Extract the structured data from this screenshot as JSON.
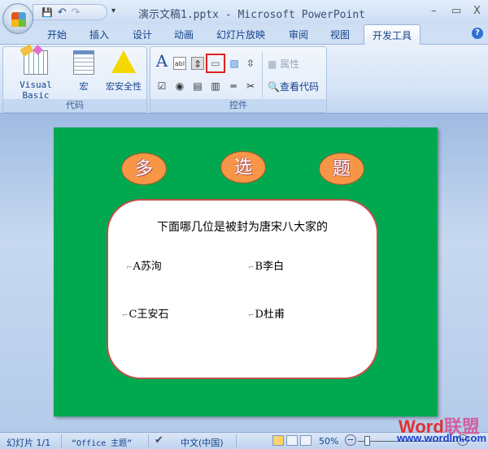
{
  "window": {
    "title": "演示文稿1.pptx - Microsoft PowerPoint",
    "minimize": "–",
    "maximize": "▭",
    "close": "X"
  },
  "qat": {
    "save": "💾",
    "undo": "↶",
    "redo": "↷",
    "more": "▾"
  },
  "tabs": [
    "开始",
    "插入",
    "设计",
    "动画",
    "幻灯片放映",
    "审阅",
    "视图"
  ],
  "active_tab": "开发工具",
  "help": "?",
  "ribbon": {
    "code_group": {
      "label": "代码",
      "buttons": [
        "Visual Basic",
        "宏",
        "宏安全性"
      ]
    },
    "controls_group": {
      "label": "控件",
      "properties": "属性",
      "view_code": "查看代码",
      "icons_row1": [
        "A",
        "abl",
        "⇕",
        "▭",
        "▧",
        "⇳"
      ],
      "icons_row2": [
        "☑",
        "◉",
        "▤",
        "▥",
        "═",
        "✂"
      ]
    }
  },
  "slide": {
    "ovals": [
      "多",
      "选",
      "题"
    ],
    "question": "下面哪几位是被封为唐宋八大家的",
    "options": [
      "A苏洵",
      "B李白",
      "C王安石",
      "D杜甫"
    ],
    "checkbox_glyph": "⌐"
  },
  "status": {
    "slide": "幻灯片 1/1",
    "theme": "“Office 主题”",
    "language": "中文(中国)",
    "zoom": "50%",
    "zoom_out": "−",
    "zoom_in": "+"
  },
  "watermark": {
    "brand_a": "Word",
    "brand_b": "联盟",
    "url": "www.wordlm.com"
  }
}
